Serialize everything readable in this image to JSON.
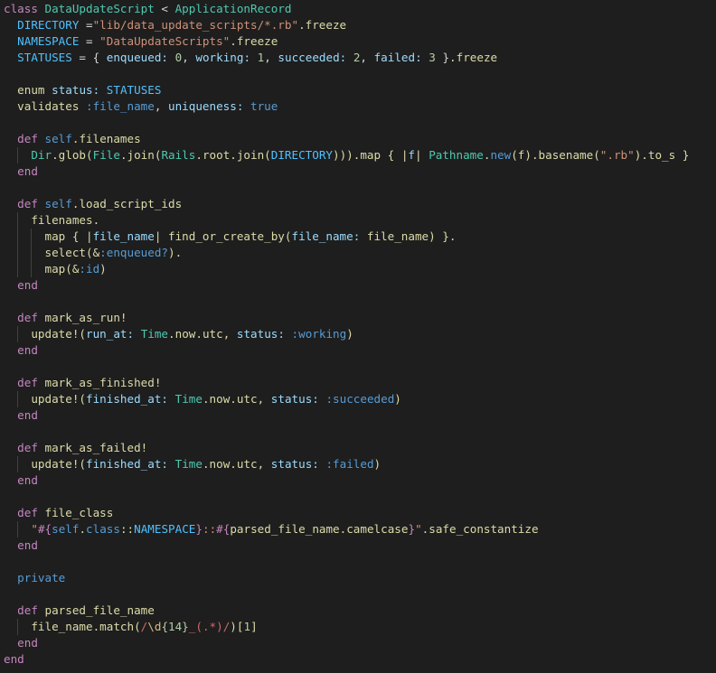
{
  "editor": {
    "language": "ruby",
    "theme_colors": {
      "background": "#1e1e1e",
      "keyword": "#569cd6",
      "definition_keyword": "#c586c0",
      "class_name": "#4ec9b0",
      "constant": "#4fc1ff",
      "string": "#ce9178",
      "number": "#b5cea8",
      "function": "#dcdcaa",
      "variable": "#9cdcfe",
      "regex": "#d16969",
      "text": "#d4d4d4"
    },
    "lines": [
      [
        [
          "class ",
          "def"
        ],
        [
          "DataUpdateScript",
          "class"
        ],
        [
          " < ",
          "plain"
        ],
        [
          "ApplicationRecord",
          "class"
        ]
      ],
      [
        [
          "  ",
          "plain"
        ],
        [
          "DIRECTORY",
          "const"
        ],
        [
          " =",
          "plain"
        ],
        [
          "\"lib/data_update_scripts/*.rb\"",
          "str"
        ],
        [
          ".freeze",
          "fn"
        ]
      ],
      [
        [
          "  ",
          "plain"
        ],
        [
          "NAMESPACE",
          "const"
        ],
        [
          " = ",
          "plain"
        ],
        [
          "\"DataUpdateScripts\"",
          "str"
        ],
        [
          ".freeze",
          "fn"
        ]
      ],
      [
        [
          "  ",
          "plain"
        ],
        [
          "STATUSES",
          "const"
        ],
        [
          " = { ",
          "plain"
        ],
        [
          "enqueued:",
          "var"
        ],
        [
          " ",
          "plain"
        ],
        [
          "0",
          "num"
        ],
        [
          ", ",
          "plain"
        ],
        [
          "working:",
          "var"
        ],
        [
          " ",
          "plain"
        ],
        [
          "1",
          "num"
        ],
        [
          ", ",
          "plain"
        ],
        [
          "succeeded:",
          "var"
        ],
        [
          " ",
          "plain"
        ],
        [
          "2",
          "num"
        ],
        [
          ", ",
          "plain"
        ],
        [
          "failed:",
          "var"
        ],
        [
          " ",
          "plain"
        ],
        [
          "3",
          "num"
        ],
        [
          " }",
          "plain"
        ],
        [
          ".freeze",
          "fn"
        ]
      ],
      [],
      [
        [
          "  ",
          "plain"
        ],
        [
          "enum",
          "fn"
        ],
        [
          " ",
          "plain"
        ],
        [
          "status:",
          "var"
        ],
        [
          " ",
          "plain"
        ],
        [
          "STATUSES",
          "const"
        ]
      ],
      [
        [
          "  ",
          "plain"
        ],
        [
          "validates",
          "fn"
        ],
        [
          " ",
          "plain"
        ],
        [
          ":file_name",
          "sym"
        ],
        [
          ", ",
          "plain"
        ],
        [
          "uniqueness:",
          "var"
        ],
        [
          " ",
          "plain"
        ],
        [
          "true",
          "kw"
        ]
      ],
      [],
      [
        [
          "  ",
          "plain"
        ],
        [
          "def ",
          "def"
        ],
        [
          "self",
          "kw"
        ],
        [
          ".filenames",
          "fn"
        ]
      ],
      [
        [
          "    ",
          "plain"
        ],
        [
          "Dir",
          "class"
        ],
        [
          ".glob(",
          "fn"
        ],
        [
          "File",
          "class"
        ],
        [
          ".join(",
          "fn"
        ],
        [
          "Rails",
          "class"
        ],
        [
          ".root.join(",
          "fn"
        ],
        [
          "DIRECTORY",
          "const"
        ],
        [
          "))).map { |",
          "fn"
        ],
        [
          "f",
          "var"
        ],
        [
          "| ",
          "fn"
        ],
        [
          "Pathname",
          "class"
        ],
        [
          ".",
          "fn"
        ],
        [
          "new",
          "kw"
        ],
        [
          "(f).basename(",
          "fn"
        ],
        [
          "\".rb\"",
          "str"
        ],
        [
          ").to_s }",
          "fn"
        ]
      ],
      [
        [
          "  ",
          "plain"
        ],
        [
          "end",
          "def"
        ]
      ],
      [],
      [
        [
          "  ",
          "plain"
        ],
        [
          "def ",
          "def"
        ],
        [
          "self",
          "kw"
        ],
        [
          ".load_script_ids",
          "fn"
        ]
      ],
      [
        [
          "    ",
          "plain"
        ],
        [
          "filenames.",
          "fn"
        ]
      ],
      [
        [
          "      ",
          "plain"
        ],
        [
          "map { |",
          "fn"
        ],
        [
          "file_name",
          "var"
        ],
        [
          "| find_or_create_by(",
          "fn"
        ],
        [
          "file_name:",
          "var"
        ],
        [
          " file_name) }.",
          "fn"
        ]
      ],
      [
        [
          "      ",
          "plain"
        ],
        [
          "select(&",
          "fn"
        ],
        [
          ":enqueued?",
          "sym"
        ],
        [
          ").",
          "fn"
        ]
      ],
      [
        [
          "      ",
          "plain"
        ],
        [
          "map(&",
          "fn"
        ],
        [
          ":id",
          "sym"
        ],
        [
          ")",
          "fn"
        ]
      ],
      [
        [
          "  ",
          "plain"
        ],
        [
          "end",
          "def"
        ]
      ],
      [],
      [
        [
          "  ",
          "plain"
        ],
        [
          "def ",
          "def"
        ],
        [
          "mark_as_run!",
          "fn"
        ]
      ],
      [
        [
          "    ",
          "plain"
        ],
        [
          "update!(",
          "fn"
        ],
        [
          "run_at:",
          "var"
        ],
        [
          " ",
          "plain"
        ],
        [
          "Time",
          "class"
        ],
        [
          ".now.utc, ",
          "fn"
        ],
        [
          "status:",
          "var"
        ],
        [
          " ",
          "plain"
        ],
        [
          ":working",
          "sym"
        ],
        [
          ")",
          "fn"
        ]
      ],
      [
        [
          "  ",
          "plain"
        ],
        [
          "end",
          "def"
        ]
      ],
      [],
      [
        [
          "  ",
          "plain"
        ],
        [
          "def ",
          "def"
        ],
        [
          "mark_as_finished!",
          "fn"
        ]
      ],
      [
        [
          "    ",
          "plain"
        ],
        [
          "update!(",
          "fn"
        ],
        [
          "finished_at:",
          "var"
        ],
        [
          " ",
          "plain"
        ],
        [
          "Time",
          "class"
        ],
        [
          ".now.utc, ",
          "fn"
        ],
        [
          "status:",
          "var"
        ],
        [
          " ",
          "plain"
        ],
        [
          ":succeeded",
          "sym"
        ],
        [
          ")",
          "fn"
        ]
      ],
      [
        [
          "  ",
          "plain"
        ],
        [
          "end",
          "def"
        ]
      ],
      [],
      [
        [
          "  ",
          "plain"
        ],
        [
          "def ",
          "def"
        ],
        [
          "mark_as_failed!",
          "fn"
        ]
      ],
      [
        [
          "    ",
          "plain"
        ],
        [
          "update!(",
          "fn"
        ],
        [
          "finished_at:",
          "var"
        ],
        [
          " ",
          "plain"
        ],
        [
          "Time",
          "class"
        ],
        [
          ".now.utc, ",
          "fn"
        ],
        [
          "status:",
          "var"
        ],
        [
          " ",
          "plain"
        ],
        [
          ":failed",
          "sym"
        ],
        [
          ")",
          "fn"
        ]
      ],
      [
        [
          "  ",
          "plain"
        ],
        [
          "end",
          "def"
        ]
      ],
      [],
      [
        [
          "  ",
          "plain"
        ],
        [
          "def ",
          "def"
        ],
        [
          "file_class",
          "fn"
        ]
      ],
      [
        [
          "    ",
          "plain"
        ],
        [
          "\"",
          "str"
        ],
        [
          "#{",
          "def"
        ],
        [
          "self",
          "kw"
        ],
        [
          ".",
          "fn"
        ],
        [
          "class",
          "kw"
        ],
        [
          "::",
          "fn"
        ],
        [
          "NAMESPACE",
          "const"
        ],
        [
          "}",
          "def"
        ],
        [
          "::",
          "str"
        ],
        [
          "#{",
          "def"
        ],
        [
          "parsed_file_name.camelcase",
          "fn"
        ],
        [
          "}",
          "def"
        ],
        [
          "\"",
          "str"
        ],
        [
          ".safe_constantize",
          "fn"
        ]
      ],
      [
        [
          "  ",
          "plain"
        ],
        [
          "end",
          "def"
        ]
      ],
      [],
      [
        [
          "  ",
          "plain"
        ],
        [
          "private",
          "kw"
        ]
      ],
      [],
      [
        [
          "  ",
          "plain"
        ],
        [
          "def ",
          "def"
        ],
        [
          "parsed_file_name",
          "fn"
        ]
      ],
      [
        [
          "    ",
          "plain"
        ],
        [
          "file_name.match(",
          "fn"
        ],
        [
          "/",
          "rx"
        ],
        [
          "\\d",
          "esc"
        ],
        [
          "{14}",
          "num"
        ],
        [
          "_(.*)",
          "rx"
        ],
        [
          "/",
          "rx"
        ],
        [
          ")[",
          "fn"
        ],
        [
          "1",
          "num"
        ],
        [
          "]",
          "fn"
        ]
      ],
      [
        [
          "  ",
          "plain"
        ],
        [
          "end",
          "def"
        ]
      ],
      [
        [
          "end",
          "def"
        ]
      ]
    ]
  }
}
